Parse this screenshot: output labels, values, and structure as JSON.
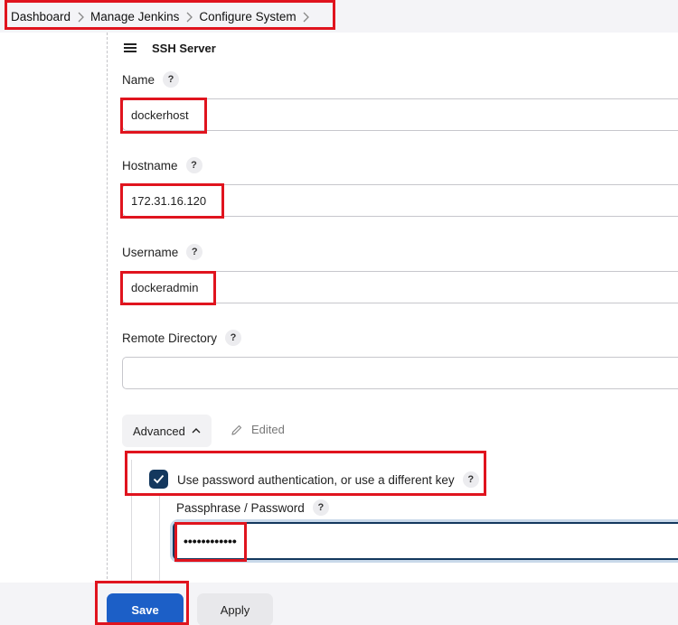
{
  "breadcrumb": {
    "items": [
      "Dashboard",
      "Manage Jenkins",
      "Configure System"
    ]
  },
  "section": {
    "title": "SSH Server"
  },
  "fields": {
    "name": {
      "label": "Name",
      "value": "dockerhost"
    },
    "hostname": {
      "label": "Hostname",
      "value": "172.31.16.120"
    },
    "username": {
      "label": "Username",
      "value": "dockeradmin"
    },
    "remote_directory": {
      "label": "Remote Directory",
      "value": ""
    }
  },
  "help_icon": "?",
  "advanced": {
    "label": "Advanced",
    "edited_label": "Edited"
  },
  "password_auth": {
    "label": "Use password authentication, or use a different key",
    "checked": true
  },
  "passphrase": {
    "label": "Passphrase / Password",
    "value": "••••••••••••"
  },
  "actions": {
    "save_label": "Save",
    "apply_label": "Apply"
  },
  "colors": {
    "accent": "#1c5fc7",
    "checkbox": "#14385e",
    "highlight": "#e0141e"
  },
  "icons": {
    "drag_handle": "hamburger-icon",
    "breadcrumb_separator": "chevron-right-icon",
    "advanced_toggle": "chevron-up-icon",
    "edited": "pencil-icon",
    "checkbox": "checkmark-icon",
    "help": "help-icon"
  }
}
